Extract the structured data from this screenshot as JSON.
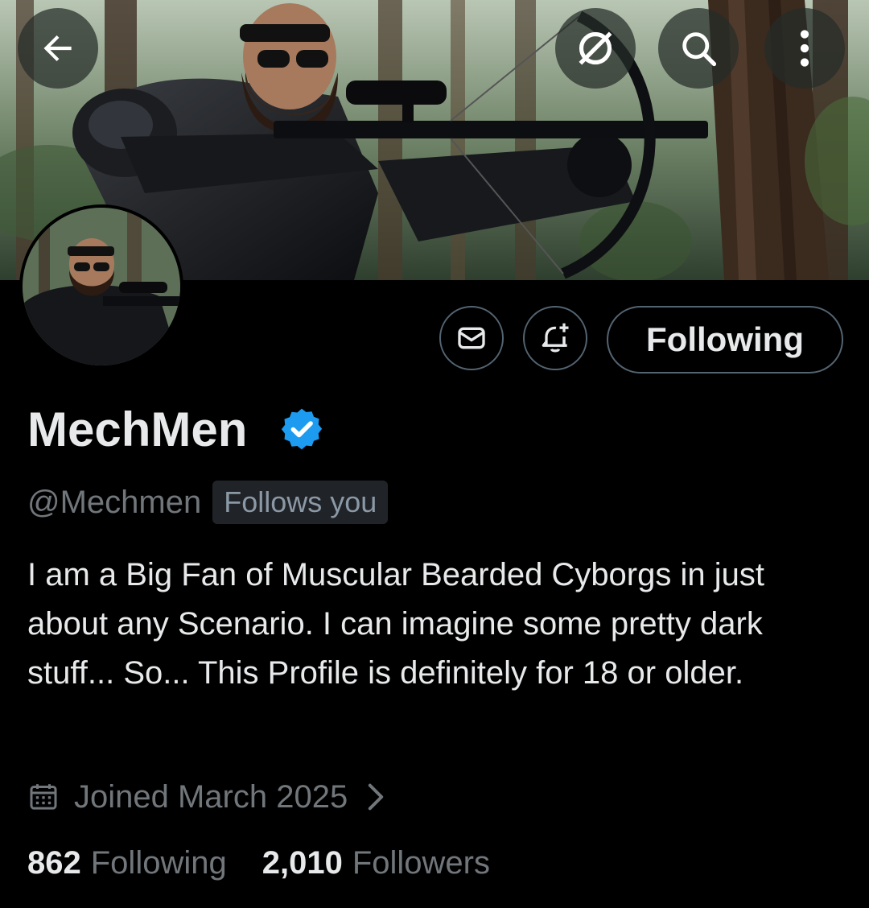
{
  "header": {
    "back_icon": "arrow-left-icon",
    "grok_icon": "grok-icon",
    "search_icon": "search-icon",
    "more_icon": "more-vertical-icon"
  },
  "banner": {
    "image": "bearded cyborg in black armor aiming a crossbow in a forest"
  },
  "avatar": {
    "image": "bearded cyborg with sunglasses aiming a rifle"
  },
  "actions": {
    "message_icon": "envelope-icon",
    "notify_icon": "bell-plus-icon",
    "follow_label": "Following"
  },
  "profile": {
    "display_name": "MechMen",
    "verified_icon": "verified-badge-icon",
    "handle": "@Mechmen",
    "follows_you": "Follows you",
    "bio": "I am a Big Fan of Muscular Bearded Cyborgs in just about any Scenario. I can imagine some pretty dark stuff... So... This Profile is definitely for 18 or older.",
    "joined": "Joined March 2025",
    "joined_icon": "calendar-icon"
  },
  "stats": {
    "following_count": "862",
    "following_label": "Following",
    "followers_count": "2,010",
    "followers_label": "Followers"
  },
  "colors": {
    "background": "#000000",
    "primary_text": "#e7e9ea",
    "secondary_text": "#71767b",
    "border": "#536471",
    "verified": "#1d9bf0"
  }
}
